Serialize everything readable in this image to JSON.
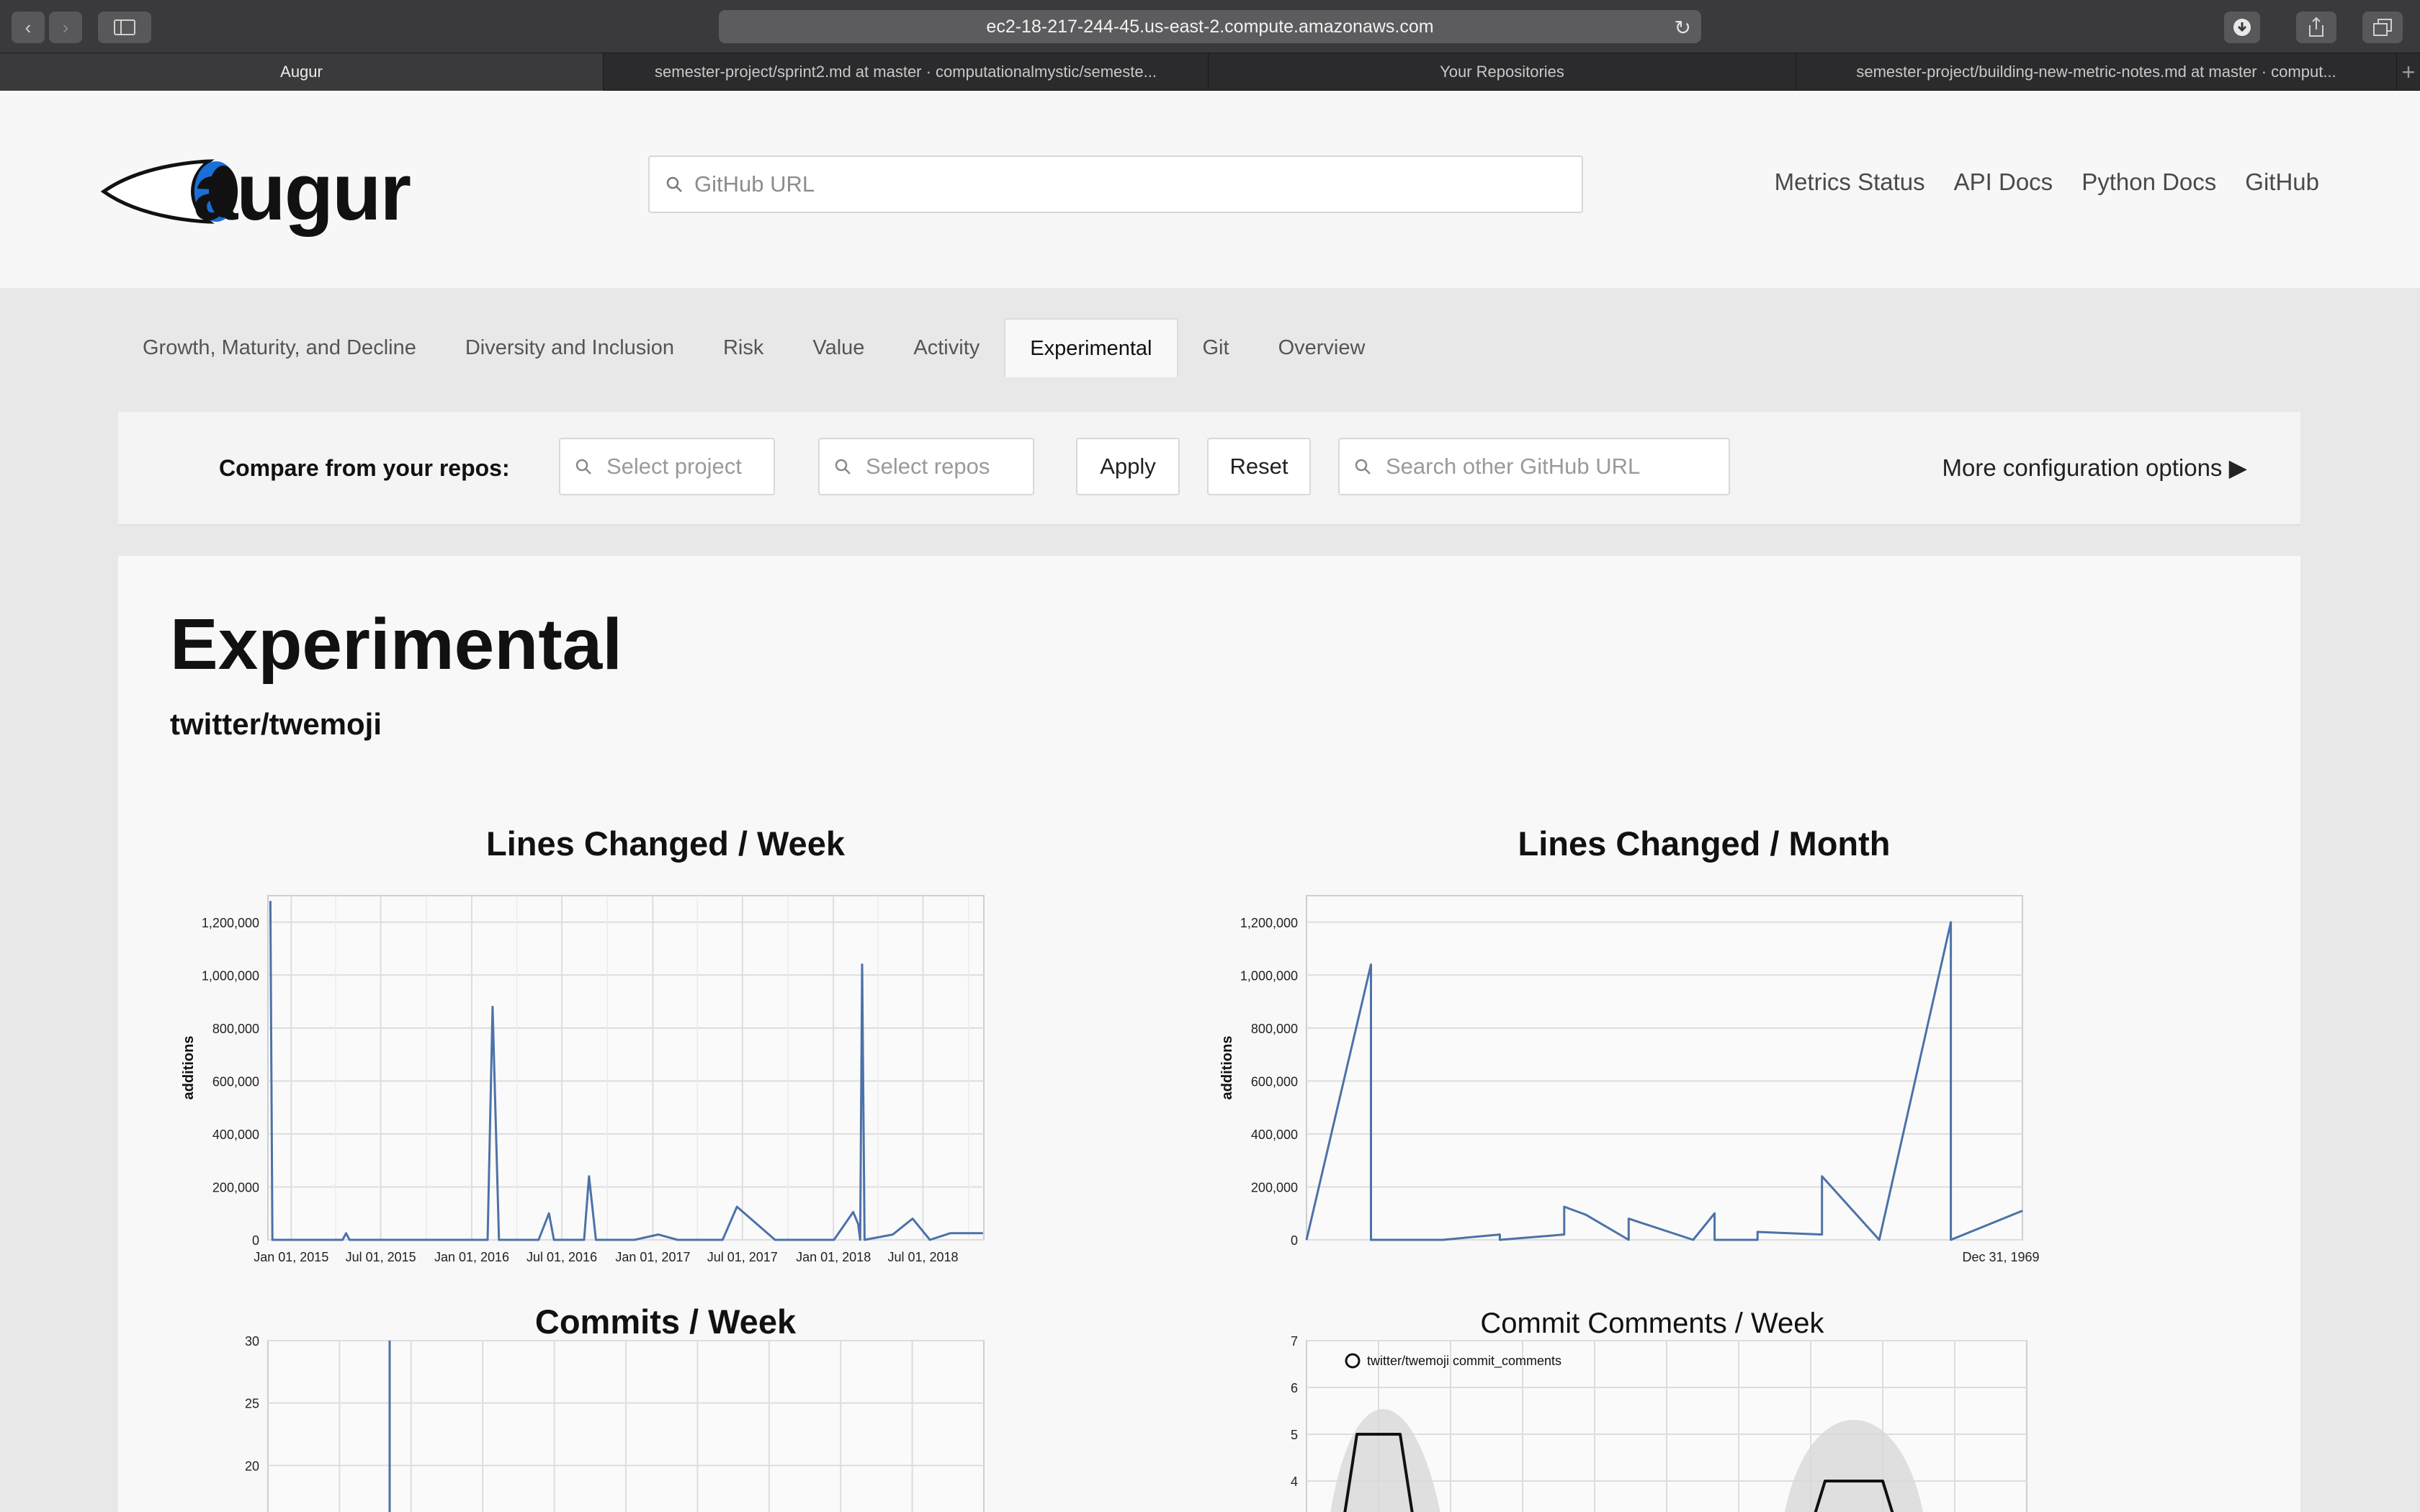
{
  "browser": {
    "url": "ec2-18-217-244-45.us-east-2.compute.amazonaws.com",
    "tabs": [
      {
        "label": "Augur"
      },
      {
        "label": "semester-project/sprint2.md at master · computationalmystic/semeste..."
      },
      {
        "label": "Your Repositories"
      },
      {
        "label": "semester-project/building-new-metric-notes.md at master · comput..."
      }
    ]
  },
  "header": {
    "logo_text": "augur",
    "search_placeholder": "GitHub URL",
    "nav": [
      {
        "label": "Metrics Status"
      },
      {
        "label": "API Docs"
      },
      {
        "label": "Python Docs"
      },
      {
        "label": "GitHub"
      }
    ]
  },
  "metric_tabs": [
    {
      "label": "Growth, Maturity, and Decline",
      "active": false
    },
    {
      "label": "Diversity and Inclusion",
      "active": false
    },
    {
      "label": "Risk",
      "active": false
    },
    {
      "label": "Value",
      "active": false
    },
    {
      "label": "Activity",
      "active": false
    },
    {
      "label": "Experimental",
      "active": true
    },
    {
      "label": "Git",
      "active": false
    },
    {
      "label": "Overview",
      "active": false
    }
  ],
  "compare": {
    "label": "Compare from your repos:",
    "project_placeholder": "Select project",
    "repos_placeholder": "Select repos",
    "apply_label": "Apply",
    "reset_label": "Reset",
    "other_placeholder": "Search other GitHub URL",
    "more_options": "More configuration options"
  },
  "page": {
    "title": "Experimental",
    "repo": "twitter/twemoji"
  },
  "colors": {
    "series": "#4c72a8",
    "grid": "#dddddd"
  },
  "chart_data": [
    {
      "type": "line",
      "title": "Lines Changed / Week",
      "ylabel": "additions",
      "ylim": [
        0,
        1300000
      ],
      "yticks": [
        "0",
        "200,000",
        "400,000",
        "600,000",
        "800,000",
        "1,000,000",
        "1,200,000"
      ],
      "xticks": [
        "Jan 01, 2015",
        "Jul 01, 2015",
        "Jan 01, 2016",
        "Jul 01, 2016",
        "Jan 01, 2017",
        "Jul 01, 2017",
        "Jan 01, 2018",
        "Jul 01, 2018"
      ],
      "x": [
        "2014-11-20",
        "2014-11-24",
        "2015-01-15",
        "2015-04-15",
        "2015-04-22",
        "2015-04-29",
        "2015-09-01",
        "2016-02-02",
        "2016-02-12",
        "2016-02-25",
        "2016-05-15",
        "2016-06-05",
        "2016-06-15",
        "2016-08-15",
        "2016-08-25",
        "2016-09-08",
        "2016-09-18",
        "2016-11-25",
        "2017-01-12",
        "2017-02-20",
        "2017-05-22",
        "2017-06-20",
        "2017-09-05",
        "2017-11-25",
        "2018-01-02",
        "2018-02-10",
        "2018-02-20",
        "2018-02-24",
        "2018-02-28",
        "2018-03-05",
        "2018-05-01",
        "2018-06-10",
        "2018-07-15",
        "2018-08-25",
        "2018-10-30"
      ],
      "values": [
        1280000,
        0,
        0,
        0,
        25000,
        0,
        0,
        0,
        880000,
        0,
        0,
        100000,
        0,
        0,
        240000,
        0,
        0,
        0,
        20000,
        0,
        0,
        125000,
        0,
        0,
        0,
        105000,
        60000,
        0,
        1040000,
        0,
        20000,
        80000,
        0,
        25000,
        25000
      ]
    },
    {
      "type": "line",
      "title": "Lines Changed / Month",
      "ylabel": "additions",
      "ylim": [
        0,
        1300000
      ],
      "yticks": [
        "0",
        "200,000",
        "400,000",
        "600,000",
        "800,000",
        "1,000,000",
        "1,200,000"
      ],
      "xticks": [
        "Dec 31, 1969"
      ],
      "x": [
        0,
        0.09,
        0.09,
        0.19,
        0.27,
        0.27,
        0.36,
        0.36,
        0.39,
        0.45,
        0.45,
        0.54,
        0.54,
        0.57,
        0.57,
        0.63,
        0.63,
        0.72,
        0.72,
        0.8,
        0.8,
        0.9,
        0.9,
        1.0
      ],
      "values": [
        0,
        1040000,
        0,
        0,
        20000,
        0,
        20000,
        125000,
        95000,
        0,
        80000,
        0,
        0,
        100000,
        0,
        0,
        30000,
        20000,
        240000,
        0,
        0,
        1200000,
        0,
        110000
      ]
    },
    {
      "type": "line",
      "title": "Commits / Week",
      "ylim": [
        15,
        30
      ],
      "yticks": [
        "20",
        "25",
        "30"
      ],
      "x": [
        0.17,
        0.17
      ],
      "values": [
        15,
        30
      ]
    },
    {
      "type": "line",
      "title": "Commit Comments / Week",
      "ylim": [
        3,
        7
      ],
      "yticks": [
        "4",
        "5",
        "6",
        "7"
      ],
      "legend": "twitter/twemoji commit_comments",
      "x": [
        0.05,
        0.07,
        0.13,
        0.15,
        0.7,
        0.72,
        0.8,
        0.82
      ],
      "values": [
        3,
        5,
        5,
        3,
        3,
        4,
        4,
        3
      ]
    }
  ]
}
